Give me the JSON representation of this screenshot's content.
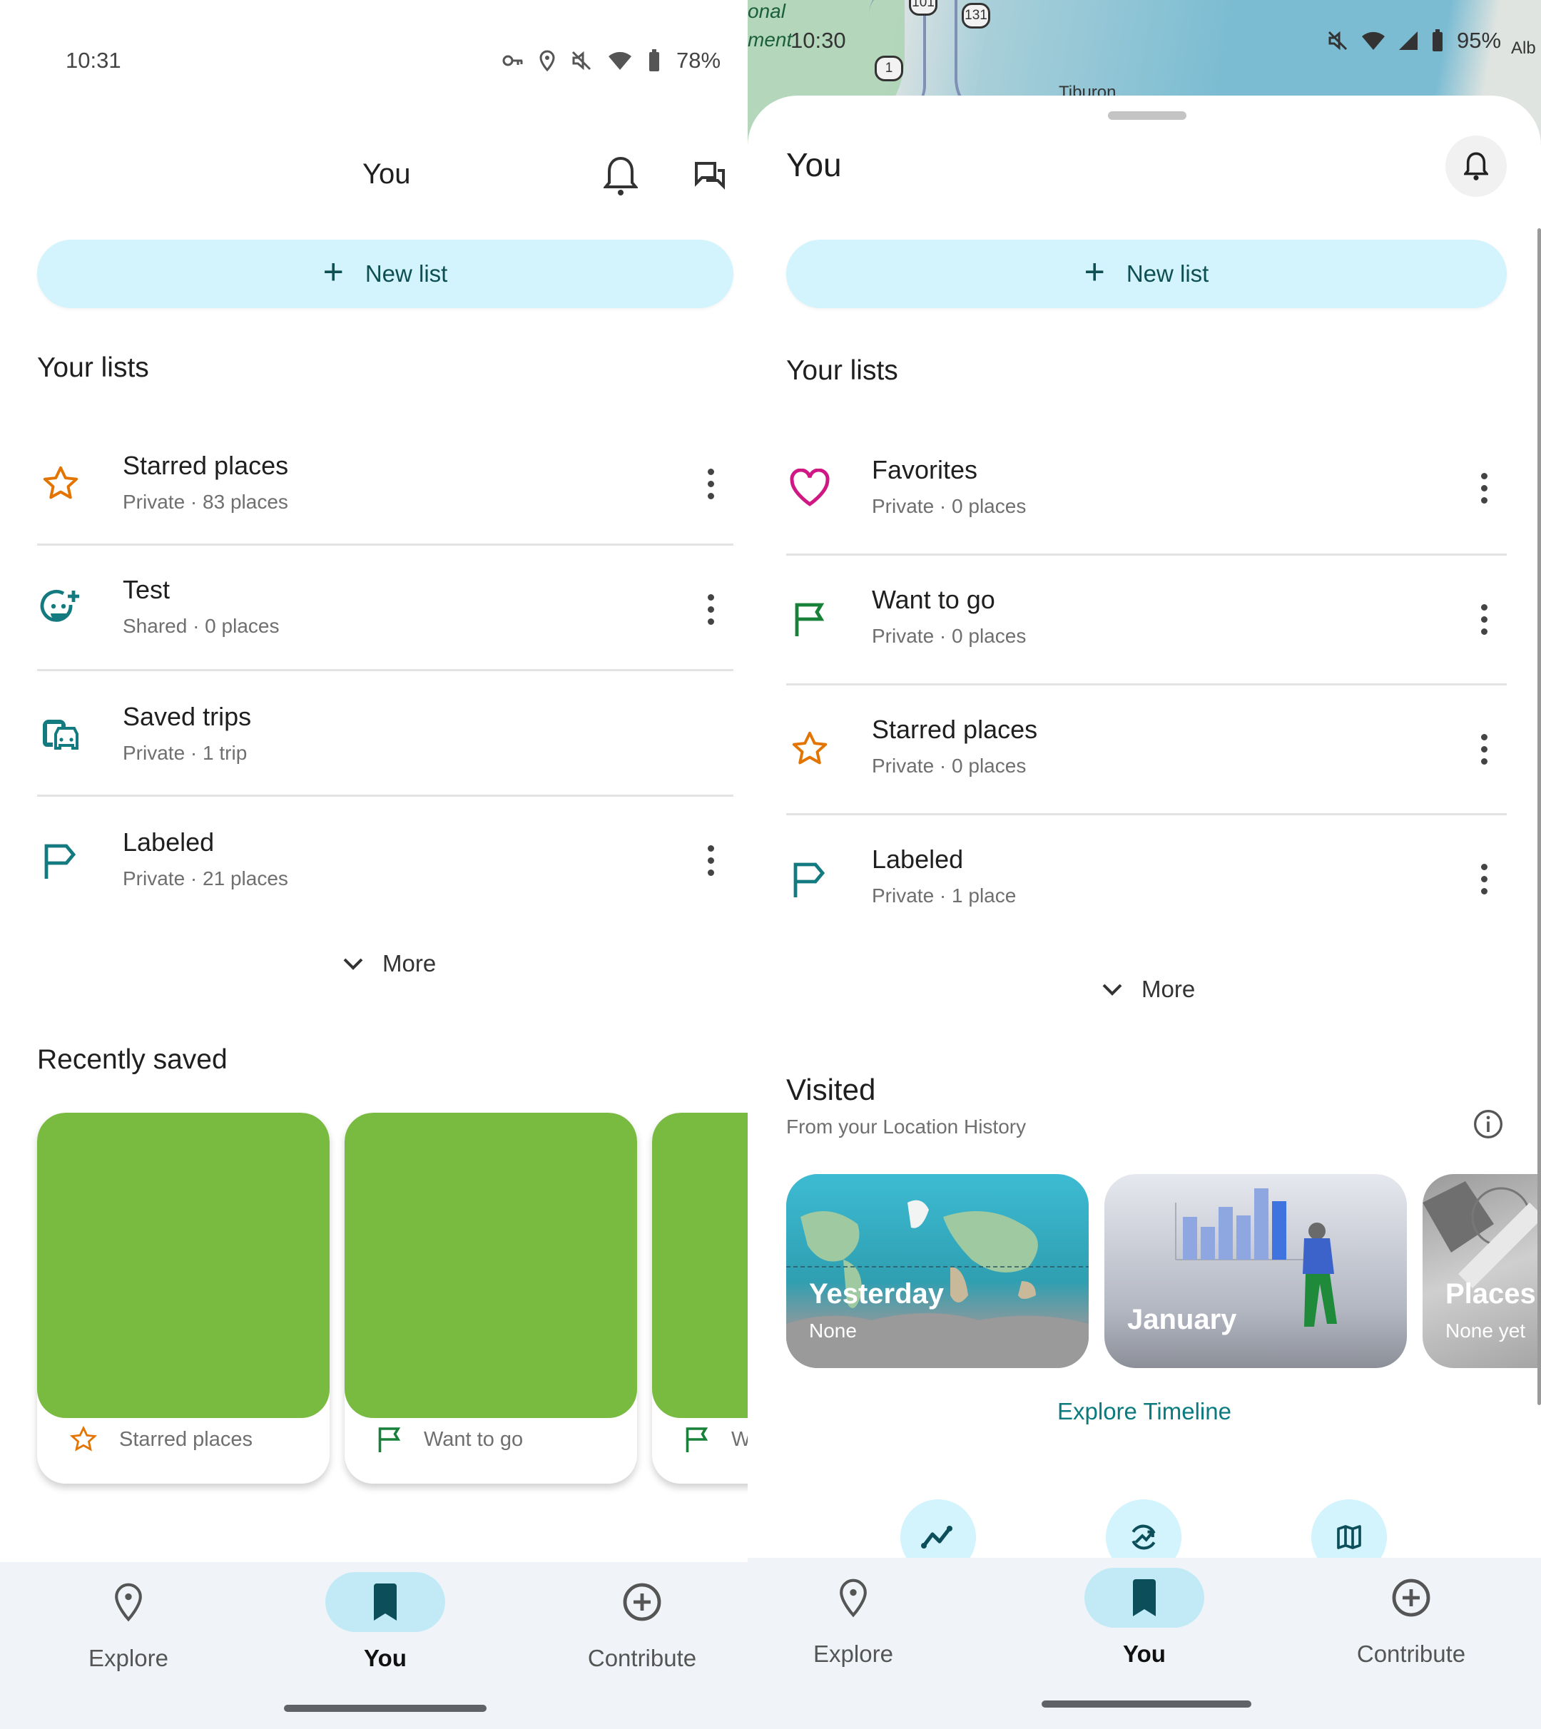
{
  "left_screen": {
    "status_bar": {
      "time": "10:31",
      "icons": [
        "vpn-key-icon",
        "location-icon",
        "mute-icon",
        "wifi-icon",
        "battery-icon"
      ],
      "battery": "78%"
    },
    "header": {
      "title": "You"
    },
    "new_list_button": {
      "label": "New list"
    },
    "your_lists": {
      "title": "Your lists",
      "items": [
        {
          "title": "Starred places",
          "subtitle": "Private · 83 places",
          "icon": "star-icon",
          "color": "#e37400",
          "has_menu": true
        },
        {
          "title": "Test",
          "subtitle": "Shared · 0 places",
          "icon": "smiley-add-icon",
          "color": "#137a80",
          "has_menu": true
        },
        {
          "title": "Saved trips",
          "subtitle": "Private · 1 trip",
          "icon": "transit-car-icon",
          "color": "#137a80",
          "has_menu": false
        },
        {
          "title": "Labeled",
          "subtitle": "Private · 21 places",
          "icon": "label-flag-icon",
          "color": "#137a80",
          "has_menu": true
        }
      ],
      "more_label": "More"
    },
    "recently_saved": {
      "title": "Recently saved",
      "cards": [
        {
          "list": "Starred places",
          "icon": "star-icon",
          "color": "#e37400"
        },
        {
          "list": "Want to go",
          "icon": "flag-icon",
          "color": "#188038"
        },
        {
          "list": "W",
          "icon": "flag-icon",
          "color": "#188038"
        }
      ]
    },
    "bottom_nav": {
      "items": [
        {
          "label": "Explore",
          "icon": "location-pin-icon",
          "active": false
        },
        {
          "label": "You",
          "icon": "bookmark-icon",
          "active": true
        },
        {
          "label": "Contribute",
          "icon": "add-circle-icon",
          "active": false
        }
      ]
    }
  },
  "right_screen": {
    "status_bar": {
      "time": "10:30",
      "icons": [
        "mute-icon",
        "wifi-icon",
        "signal-icon",
        "battery-icon"
      ],
      "battery": "95%"
    },
    "map": {
      "labels": [
        "onal",
        "ment",
        "Tiburon",
        "Alb"
      ],
      "shields": [
        "101",
        "131",
        "1"
      ]
    },
    "header": {
      "title": "You"
    },
    "new_list_button": {
      "label": "New list"
    },
    "your_lists": {
      "title": "Your lists",
      "items": [
        {
          "title": "Favorites",
          "subtitle": "Private · 0 places",
          "icon": "heart-icon",
          "color": "#d01884"
        },
        {
          "title": "Want to go",
          "subtitle": "Private · 0 places",
          "icon": "flag-icon",
          "color": "#188038"
        },
        {
          "title": "Starred places",
          "subtitle": "Private · 0 places",
          "icon": "star-icon",
          "color": "#e37400"
        },
        {
          "title": "Labeled",
          "subtitle": "Private · 1 place",
          "icon": "label-flag-icon",
          "color": "#137a80"
        }
      ],
      "more_label": "More"
    },
    "visited": {
      "title": "Visited",
      "subtitle": "From your Location History",
      "cards": [
        {
          "title": "Yesterday",
          "subtitle": "None"
        },
        {
          "title": "January",
          "subtitle": ""
        },
        {
          "title": "Places",
          "subtitle": "None yet"
        }
      ],
      "explore_timeline": "Explore Timeline",
      "quick_actions": [
        "trips-line-icon",
        "insights-icon",
        "map-icon"
      ]
    },
    "bottom_nav": {
      "items": [
        {
          "label": "Explore",
          "icon": "location-pin-icon",
          "active": false
        },
        {
          "label": "You",
          "icon": "bookmark-icon",
          "active": true
        },
        {
          "label": "Contribute",
          "icon": "add-circle-icon",
          "active": false
        }
      ]
    }
  },
  "colors": {
    "accent_teal": "#0b7b80",
    "new_list_bg": "#d3f4fd",
    "nav_active_bg": "#c2eaf6",
    "nav_bg": "#f0f4f8",
    "photo_placeholder": "#79bb41"
  }
}
